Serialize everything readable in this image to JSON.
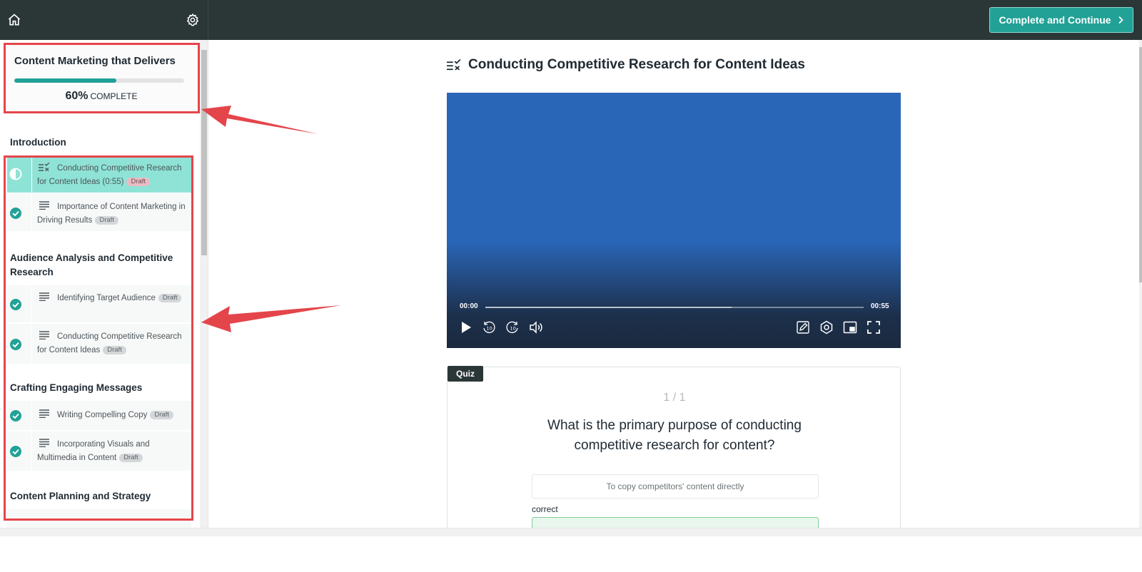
{
  "topbar": {
    "home_icon": "home-icon",
    "settings_icon": "gear-icon",
    "complete_button_label": "Complete and Continue",
    "accent_color": "#22a196"
  },
  "course": {
    "title": "Content Marketing that Delivers",
    "progress_percent": 60,
    "progress_label": "60%",
    "progress_suffix": "COMPLETE"
  },
  "sections": [
    {
      "title": "Introduction",
      "lessons": [
        {
          "icon": "quiz-icon",
          "title": "Conducting Competitive Research for Content Ideas (0:55)",
          "badge": "Draft",
          "status": "in-progress",
          "active": true
        },
        {
          "icon": "text-icon",
          "title": "Importance of Content Marketing in Driving Results",
          "badge": "Draft",
          "status": "completed",
          "active": false
        }
      ]
    },
    {
      "title": "Audience Analysis and Competitive Research",
      "lessons": [
        {
          "icon": "text-icon",
          "title": "Identifying Target Audience",
          "badge": "Draft",
          "status": "completed",
          "active": false
        },
        {
          "icon": "text-icon",
          "title": "Conducting Competitive Research for Content Ideas",
          "badge": "Draft",
          "status": "completed",
          "active": false
        }
      ]
    },
    {
      "title": "Crafting Engaging Messages",
      "lessons": [
        {
          "icon": "text-icon",
          "title": "Writing Compelling Copy",
          "badge": "Draft",
          "status": "completed",
          "active": false
        },
        {
          "icon": "text-icon",
          "title": "Incorporating Visuals and Multimedia in Content",
          "badge": "Draft",
          "status": "completed",
          "active": false
        }
      ]
    },
    {
      "title": "Content Planning and Strategy",
      "lessons": []
    }
  ],
  "main": {
    "lesson_title": "Conducting Competitive Research for Content Ideas",
    "video": {
      "current_time": "00:00",
      "duration": "00:55",
      "buffered_fraction": 0.65,
      "background_color": "#2a66b8"
    },
    "quiz": {
      "tag": "Quiz",
      "counter": "1 / 1",
      "question": "What is the primary purpose of conducting competitive research for content?",
      "answers": [
        {
          "text": "To copy competitors' content directly"
        }
      ],
      "correct_label": "correct"
    }
  },
  "annotation_color": "#e4454a"
}
